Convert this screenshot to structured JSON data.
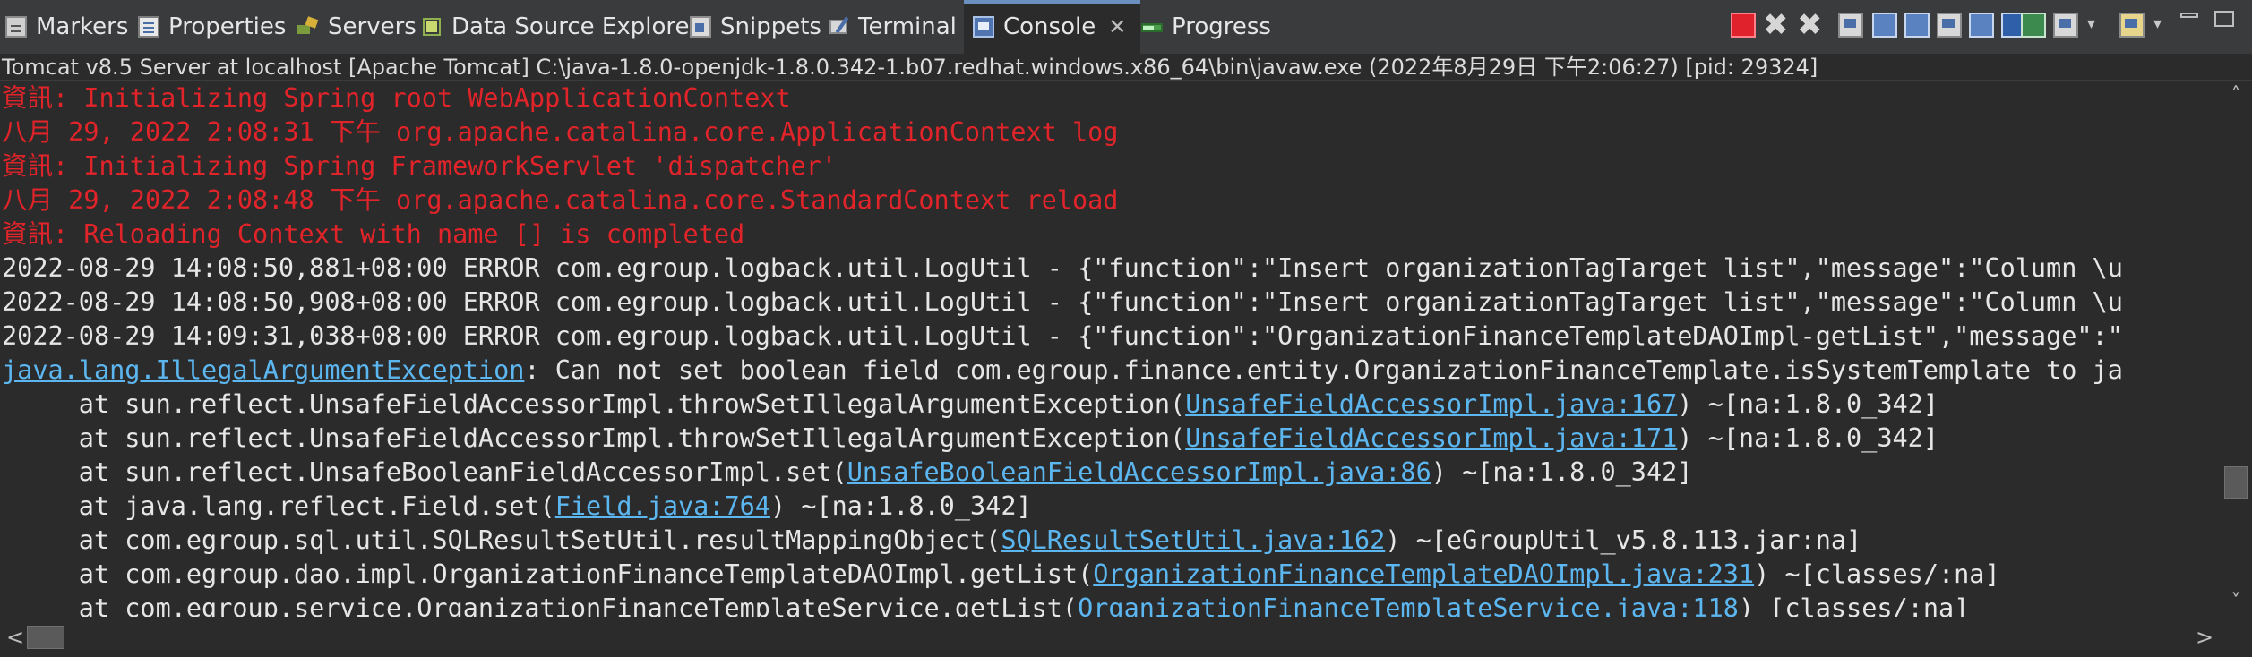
{
  "tabs": [
    {
      "label": "Markers",
      "icon": "markers-icon"
    },
    {
      "label": "Properties",
      "icon": "properties-icon"
    },
    {
      "label": "Servers",
      "icon": "servers-icon"
    },
    {
      "label": "Data Source Explorer",
      "icon": "data-source-explorer-icon"
    },
    {
      "label": "Snippets",
      "icon": "snippets-icon"
    },
    {
      "label": "Terminal",
      "icon": "terminal-icon"
    },
    {
      "label": "Console",
      "icon": "console-icon",
      "active": true,
      "close_glyph": "✕"
    },
    {
      "label": "Progress",
      "icon": "progress-icon"
    }
  ],
  "toolbar": {
    "buttons": [
      "terminate",
      "remove-launch",
      "remove-all-terminated",
      "clear-console",
      "scroll-lock",
      "word-wrap",
      "show-on-stdout",
      "show-on-stderr",
      "pin-console",
      "display-selected-console",
      "open-console",
      "view-menu"
    ],
    "minimize_glyph": "",
    "maximize_glyph": ""
  },
  "process_line": "Tomcat v8.5 Server at localhost [Apache Tomcat] C:\\java-1.8.0-openjdk-1.8.0.342-1.b07.redhat.windows.x86_64\\bin\\javaw.exe  (2022年8月29日 下午2:06:27) [pid: 29324]",
  "colors": {
    "stderr": "#e0242a",
    "stdout": "#e6e6e6",
    "link": "#5cb6f0",
    "background": "#2b2b2b"
  },
  "console": {
    "lines": [
      [
        {
          "t": "資訊: Initializing Spring root WebApplicationContext",
          "c": "red"
        }
      ],
      [
        {
          "t": "八月 29, 2022 2:08:31 下午 org.apache.catalina.core.ApplicationContext log",
          "c": "red"
        }
      ],
      [
        {
          "t": "資訊: Initializing Spring FrameworkServlet 'dispatcher'",
          "c": "red"
        }
      ],
      [
        {
          "t": "八月 29, 2022 2:08:48 下午 org.apache.catalina.core.StandardContext reload",
          "c": "red"
        }
      ],
      [
        {
          "t": "資訊: Reloading Context with name [] is completed",
          "c": "red"
        }
      ],
      [
        {
          "t": "2022-08-29 14:08:50,881+08:00 ERROR com.egroup.logback.util.LogUtil - {\"function\":\"Insert organizationTagTarget list\",\"message\":\"Column \\u",
          "c": "norm"
        }
      ],
      [
        {
          "t": "2022-08-29 14:08:50,908+08:00 ERROR com.egroup.logback.util.LogUtil - {\"function\":\"Insert organizationTagTarget list\",\"message\":\"Column \\u",
          "c": "norm"
        }
      ],
      [
        {
          "t": "2022-08-29 14:09:31,038+08:00 ERROR com.egroup.logback.util.LogUtil - {\"function\":\"OrganizationFinanceTemplateDAOImpl-getList\",\"message\":\"",
          "c": "norm"
        }
      ],
      [
        {
          "t": "java.lang.IllegalArgumentException",
          "c": "link"
        },
        {
          "t": ": Can not set boolean field com.egroup.finance.entity.OrganizationFinanceTemplate.isSystemTemplate to ja",
          "c": "norm"
        }
      ],
      [
        {
          "t": "\tat sun.reflect.UnsafeFieldAccessorImpl.throwSetIllegalArgumentException(",
          "c": "norm"
        },
        {
          "t": "UnsafeFieldAccessorImpl.java:167",
          "c": "link"
        },
        {
          "t": ") ~[na:1.8.0_342]",
          "c": "norm"
        }
      ],
      [
        {
          "t": "\tat sun.reflect.UnsafeFieldAccessorImpl.throwSetIllegalArgumentException(",
          "c": "norm"
        },
        {
          "t": "UnsafeFieldAccessorImpl.java:171",
          "c": "link"
        },
        {
          "t": ") ~[na:1.8.0_342]",
          "c": "norm"
        }
      ],
      [
        {
          "t": "\tat sun.reflect.UnsafeBooleanFieldAccessorImpl.set(",
          "c": "norm"
        },
        {
          "t": "UnsafeBooleanFieldAccessorImpl.java:86",
          "c": "link"
        },
        {
          "t": ") ~[na:1.8.0_342]",
          "c": "norm"
        }
      ],
      [
        {
          "t": "\tat java.lang.reflect.Field.set(",
          "c": "norm"
        },
        {
          "t": "Field.java:764",
          "c": "link"
        },
        {
          "t": ") ~[na:1.8.0_342]",
          "c": "norm"
        }
      ],
      [
        {
          "t": "\tat com.egroup.sql.util.SQLResultSetUtil.resultMappingObject(",
          "c": "norm"
        },
        {
          "t": "SQLResultSetUtil.java:162",
          "c": "link"
        },
        {
          "t": ") ~[eGroupUtil_v5.8.113.jar:na]",
          "c": "norm"
        }
      ],
      [
        {
          "t": "\tat com.egroup.dao.impl.OrganizationFinanceTemplateDAOImpl.getList(",
          "c": "norm"
        },
        {
          "t": "OrganizationFinanceTemplateDAOImpl.java:231",
          "c": "link"
        },
        {
          "t": ") ~[classes/:na]",
          "c": "norm"
        }
      ],
      [
        {
          "t": "\tat com.egroup.service.OrganizationFinanceTemplateService.getList(",
          "c": "norm"
        },
        {
          "t": "OrganizationFinanceTemplateService.java:118",
          "c": "link"
        },
        {
          "t": ") [classes/:na]",
          "c": "norm"
        }
      ]
    ]
  },
  "scrollbars": {
    "up_glyph": "˄",
    "down_glyph": "˅",
    "left_glyph": "<",
    "right_glyph": ">",
    "vertical_position": 0.74,
    "horizontal_position": 0.0
  }
}
